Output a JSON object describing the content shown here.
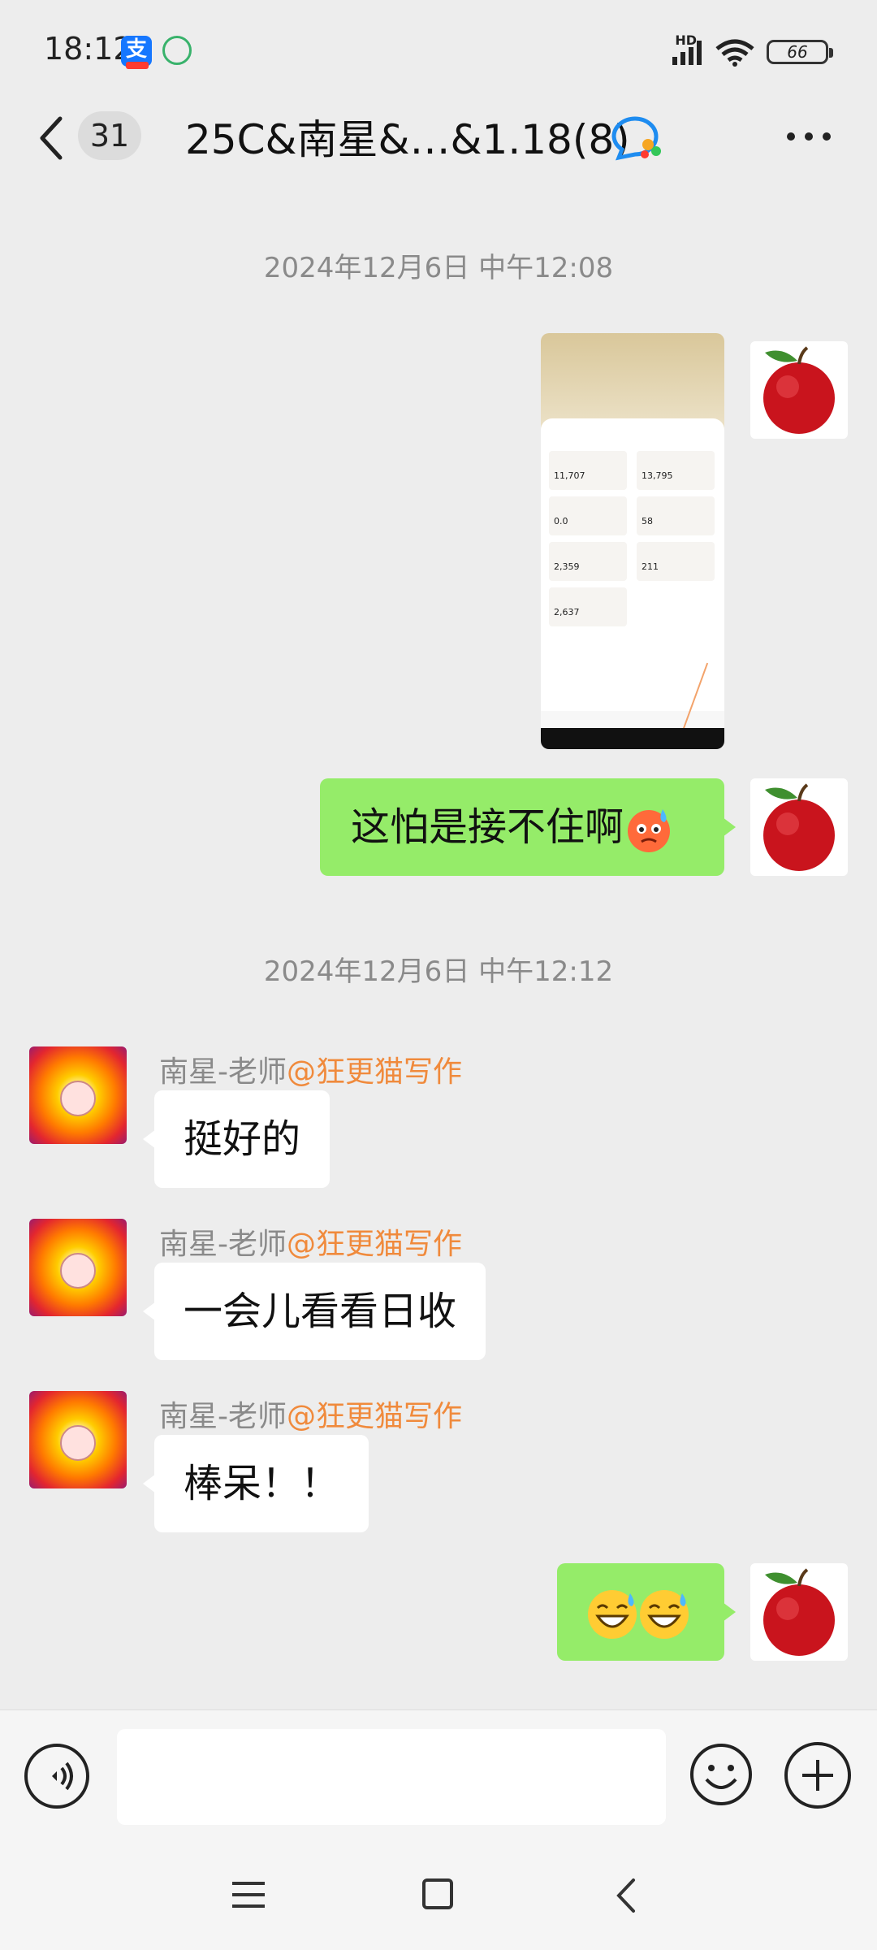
{
  "status_bar": {
    "time": "18:12",
    "app1_icon": "alipay-icon",
    "app2_icon": "charging-app-icon",
    "network_label": "HD",
    "battery": "66"
  },
  "header": {
    "unread_count": "31",
    "title": "25C&南星&…&1.18(8)",
    "title_icon": "group-chat-icon",
    "more_icon": "more-dots-icon"
  },
  "messages": [
    {
      "type": "timestamp",
      "text": "2024年12月6日 中午12:08"
    },
    {
      "type": "image",
      "side": "right",
      "image_texts": [
        "11,707",
        "13,795",
        "0.0",
        "58",
        "2,359",
        "211",
        "2,637"
      ]
    },
    {
      "type": "text",
      "side": "right",
      "text": "这怕是接不住啊",
      "emoji": "sweat-emoji"
    },
    {
      "type": "timestamp",
      "text": "2024年12月6日 中午12:12"
    },
    {
      "type": "text",
      "side": "left",
      "sender": "南星-老师",
      "mention": "@狂更猫写作",
      "text": "挺好的"
    },
    {
      "type": "text",
      "side": "left",
      "sender": "南星-老师",
      "mention": "@狂更猫写作",
      "text": "一会儿看看日收"
    },
    {
      "type": "text",
      "side": "left",
      "sender": "南星-老师",
      "mention": "@狂更猫写作",
      "text": "棒呆！！"
    },
    {
      "type": "emoji",
      "side": "right",
      "emoji": "grin-sweat-emoji",
      "count": 2
    }
  ],
  "input_bar": {
    "voice_icon": "voice-icon",
    "text_value": "",
    "emoji_icon": "emoji-icon",
    "plus_icon": "plus-icon"
  },
  "nav_bar": {
    "menu_icon": "menu-icon",
    "home_icon": "home-icon",
    "back_icon": "back-icon"
  },
  "colors": {
    "background": "#ededed",
    "my_bubble": "#95ec69",
    "mention": "#f08a3c"
  }
}
